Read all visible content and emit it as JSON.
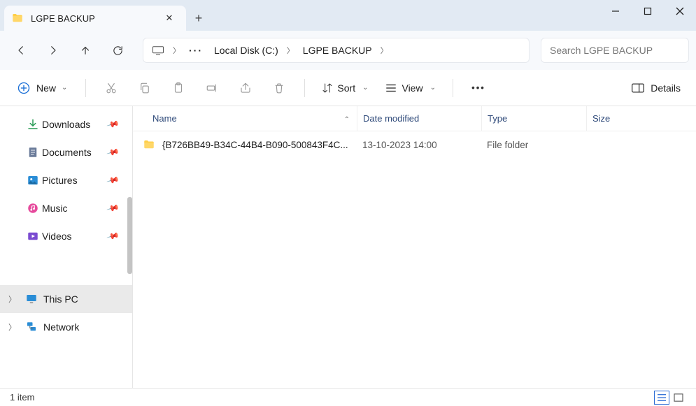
{
  "tab": {
    "title": "LGPE BACKUP"
  },
  "nav": {
    "overflow": "···",
    "crumbs": [
      "Local Disk (C:)",
      "LGPE BACKUP"
    ]
  },
  "search": {
    "placeholder": "Search LGPE BACKUP"
  },
  "toolbar": {
    "new": "New",
    "sort": "Sort",
    "view": "View",
    "details": "Details"
  },
  "sidebar": {
    "quick": [
      {
        "label": "Downloads",
        "icon": "download"
      },
      {
        "label": "Documents",
        "icon": "document"
      },
      {
        "label": "Pictures",
        "icon": "pictures"
      },
      {
        "label": "Music",
        "icon": "music"
      },
      {
        "label": "Videos",
        "icon": "videos"
      }
    ],
    "roots": [
      {
        "label": "This PC",
        "selected": true
      },
      {
        "label": "Network",
        "selected": false
      }
    ]
  },
  "columns": {
    "name": "Name",
    "date": "Date modified",
    "type": "Type",
    "size": "Size"
  },
  "rows": [
    {
      "name": "{B726BB49-B34C-44B4-B090-500843F4C...",
      "date": "13-10-2023 14:00",
      "type": "File folder",
      "size": ""
    }
  ],
  "status": {
    "count": "1 item"
  }
}
